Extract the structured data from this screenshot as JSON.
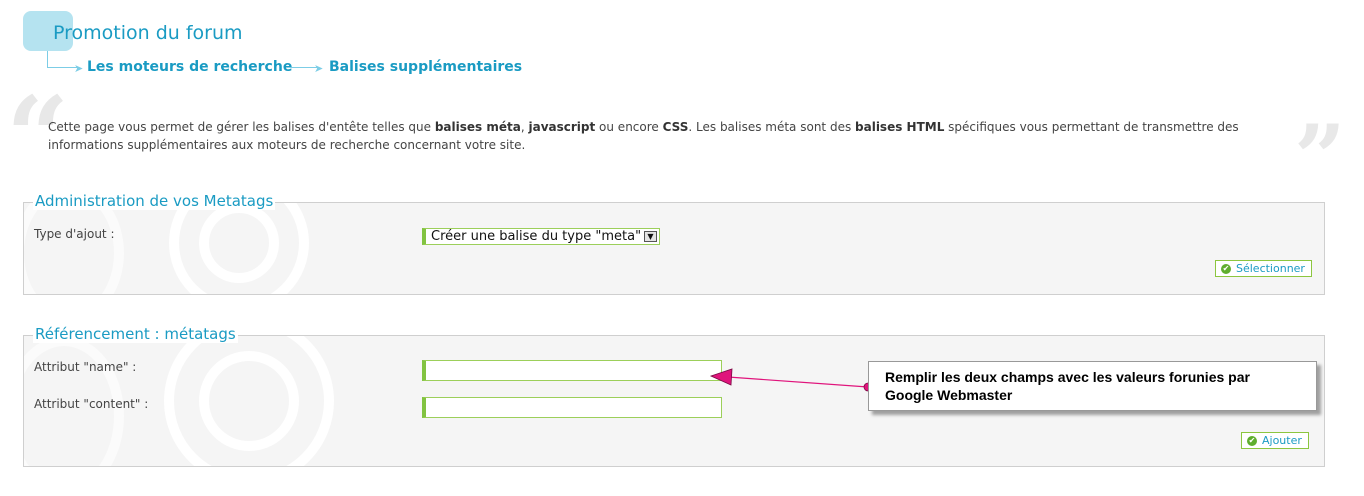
{
  "header": {
    "title": "Promotion du forum",
    "breadcrumb": [
      "Les moteurs de recherche",
      "Balises supplémentaires"
    ]
  },
  "intro": {
    "p1": "Cette page vous permet de gérer les balises d'entête telles que ",
    "b1": "balises méta",
    "p2": ", ",
    "b2": "javascript",
    "p3": " ou encore ",
    "b3": "CSS",
    "p4": ". Les balises méta sont des ",
    "b4": "balises HTML",
    "p5": " spécifiques vous permettant de transmettre des informations supplémentaires aux moteurs de recherche concernant votre site."
  },
  "admin": {
    "legend": "Administration de vos Metatags",
    "type_label": "Type d'ajout :",
    "select_value": "Créer une balise du type \"meta\"",
    "select_button": "Sélectionner"
  },
  "referencement": {
    "legend": "Référencement : métatags",
    "name_label": "Attribut \"name\" :",
    "content_label": "Attribut \"content\" :",
    "name_value": "",
    "content_value": "",
    "add_button": "Ajouter"
  },
  "callout": {
    "text": "Remplir les deux champs avec les valeurs forunies par Google Webmaster"
  },
  "colors": {
    "accent": "#1a9bc3",
    "field_border": "#82c341",
    "arrow": "#e0147c"
  }
}
